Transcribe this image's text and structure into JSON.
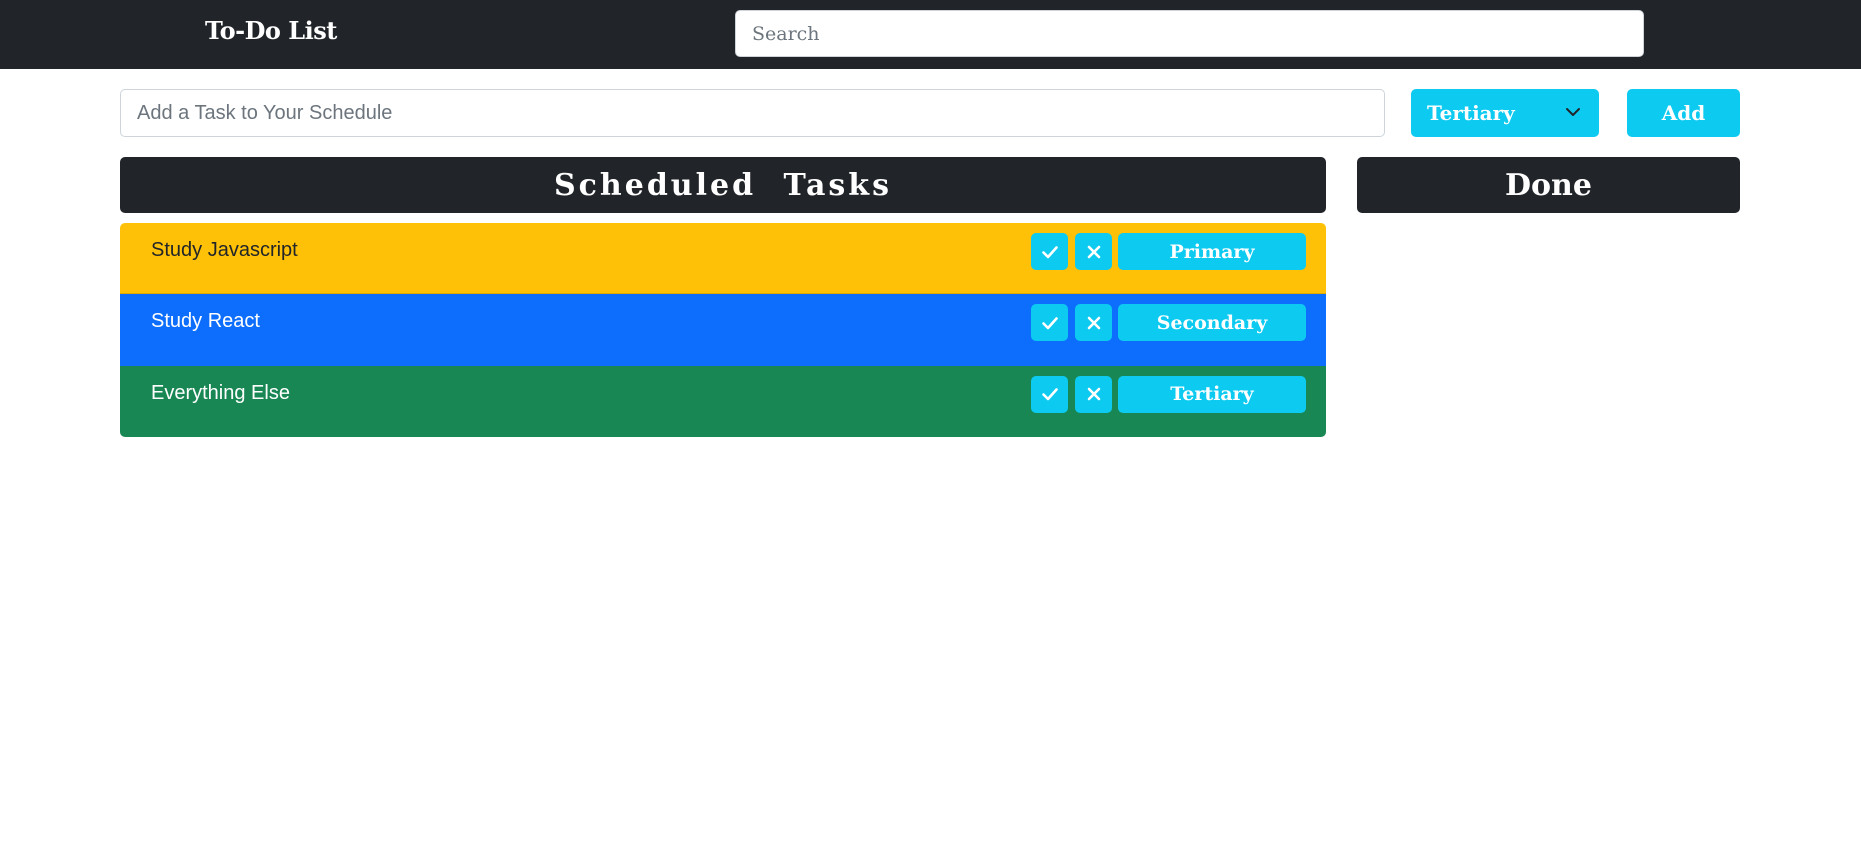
{
  "navbar": {
    "brand": "To-Do List",
    "search_placeholder": "Search"
  },
  "add_task": {
    "input_placeholder": "Add a Task to Your Schedule",
    "priority_selected": "Tertiary",
    "add_label": "Add"
  },
  "columns": {
    "scheduled_title": "Scheduled Tasks",
    "done_title": "Done"
  },
  "tasks": [
    {
      "label": "Study Javascript",
      "priority": "Primary",
      "color": "#ffc107"
    },
    {
      "label": "Study React",
      "priority": "Secondary",
      "color": "#0d6efd"
    },
    {
      "label": "Everything Else",
      "priority": "Tertiary",
      "color": "#198754"
    }
  ],
  "colors": {
    "navbar": "#212529",
    "accent": "#0dcaf0"
  },
  "icons": {
    "complete": "check-icon",
    "delete": "close-icon",
    "dropdown": "chevron-down-icon"
  }
}
